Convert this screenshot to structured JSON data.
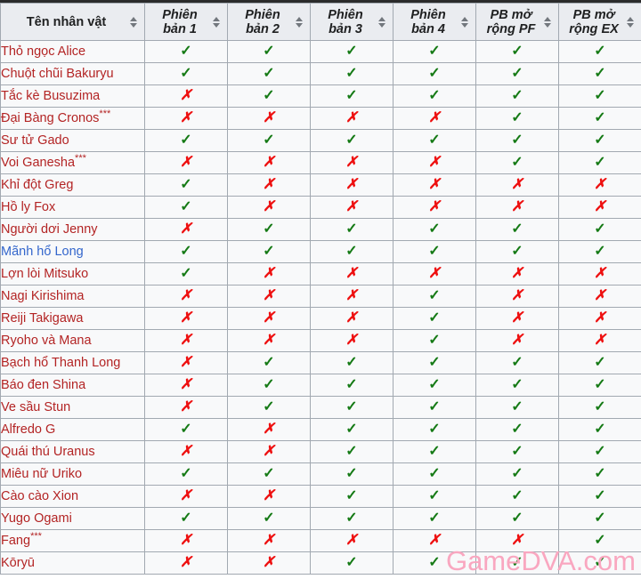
{
  "table": {
    "sort_icon_name": "sort-icon",
    "columns": [
      {
        "label": "Tên nhân vật",
        "italic": false,
        "sortable": true
      },
      {
        "label": "Phiên bản 1",
        "italic": true,
        "sortable": true
      },
      {
        "label": "Phiên bản 2",
        "italic": true,
        "sortable": true
      },
      {
        "label": "Phiên bản 3",
        "italic": true,
        "sortable": true
      },
      {
        "label": "Phiên bản 4",
        "italic": true,
        "sortable": true
      },
      {
        "label": "PB mở rộng PF",
        "italic": true,
        "sortable": true
      },
      {
        "label": "PB mở rộng EX",
        "italic": true,
        "sortable": true
      }
    ],
    "marks": {
      "yes": "✓",
      "no": "✗"
    },
    "colors": {
      "yes": "#157a15",
      "no": "#ee1111",
      "link_red": "#b32424",
      "link_blue": "#3366cc",
      "header_bg": "#eaecf0",
      "cell_bg": "#f8f9fa",
      "border": "#a2a9b1",
      "watermark": "#f9a7c0"
    },
    "rows": [
      {
        "name": "Thỏ ngọc Alice",
        "note": "",
        "link": "red",
        "values": [
          "yes",
          "yes",
          "yes",
          "yes",
          "yes",
          "yes"
        ]
      },
      {
        "name": "Chuột chũi Bakuryu",
        "note": "",
        "link": "red",
        "values": [
          "yes",
          "yes",
          "yes",
          "yes",
          "yes",
          "yes"
        ]
      },
      {
        "name": "Tắc kè Busuzima",
        "note": "",
        "link": "red",
        "values": [
          "no",
          "yes",
          "yes",
          "yes",
          "yes",
          "yes"
        ]
      },
      {
        "name": "Đại Bàng Cronos",
        "note": "***",
        "link": "red",
        "values": [
          "no",
          "no",
          "no",
          "no",
          "yes",
          "yes"
        ]
      },
      {
        "name": "Sư tử Gado",
        "note": "",
        "link": "red",
        "values": [
          "yes",
          "yes",
          "yes",
          "yes",
          "yes",
          "yes"
        ]
      },
      {
        "name": "Voi Ganesha",
        "note": "***",
        "link": "red",
        "values": [
          "no",
          "no",
          "no",
          "no",
          "yes",
          "yes"
        ]
      },
      {
        "name": "Khỉ đột Greg",
        "note": "",
        "link": "red",
        "values": [
          "yes",
          "no",
          "no",
          "no",
          "no",
          "no"
        ]
      },
      {
        "name": "Hồ ly Fox",
        "note": "",
        "link": "red",
        "values": [
          "yes",
          "no",
          "no",
          "no",
          "no",
          "no"
        ]
      },
      {
        "name": "Người dơi Jenny",
        "note": "",
        "link": "red",
        "values": [
          "no",
          "yes",
          "yes",
          "yes",
          "yes",
          "yes"
        ]
      },
      {
        "name": "Mãnh hổ Long",
        "note": "",
        "link": "blue",
        "values": [
          "yes",
          "yes",
          "yes",
          "yes",
          "yes",
          "yes"
        ]
      },
      {
        "name": "Lợn lòi Mitsuko",
        "note": "",
        "link": "red",
        "values": [
          "yes",
          "no",
          "no",
          "no",
          "no",
          "no"
        ]
      },
      {
        "name": "Nagi Kirishima",
        "note": "",
        "link": "red",
        "values": [
          "no",
          "no",
          "no",
          "yes",
          "no",
          "no"
        ]
      },
      {
        "name": "Reiji Takigawa",
        "note": "",
        "link": "red",
        "values": [
          "no",
          "no",
          "no",
          "yes",
          "no",
          "no"
        ]
      },
      {
        "name": "Ryoho và Mana",
        "note": "",
        "link": "red",
        "values": [
          "no",
          "no",
          "no",
          "yes",
          "no",
          "no"
        ]
      },
      {
        "name": "Bạch hổ Thanh Long",
        "note": "",
        "link": "red",
        "values": [
          "no",
          "yes",
          "yes",
          "yes",
          "yes",
          "yes"
        ]
      },
      {
        "name": "Báo đen Shina",
        "note": "",
        "link": "red",
        "values": [
          "no",
          "yes",
          "yes",
          "yes",
          "yes",
          "yes"
        ]
      },
      {
        "name": "Ve sầu Stun",
        "note": "",
        "link": "red",
        "values": [
          "no",
          "yes",
          "yes",
          "yes",
          "yes",
          "yes"
        ]
      },
      {
        "name": "Alfredo G",
        "note": "",
        "link": "red",
        "values": [
          "yes",
          "no",
          "yes",
          "yes",
          "yes",
          "yes"
        ]
      },
      {
        "name": "Quái thú Uranus",
        "note": "",
        "link": "red",
        "values": [
          "no",
          "no",
          "yes",
          "yes",
          "yes",
          "yes"
        ]
      },
      {
        "name": "Miêu nữ Uriko",
        "note": "",
        "link": "red",
        "values": [
          "yes",
          "yes",
          "yes",
          "yes",
          "yes",
          "yes"
        ]
      },
      {
        "name": "Cào cào Xion",
        "note": "",
        "link": "red",
        "values": [
          "no",
          "no",
          "yes",
          "yes",
          "yes",
          "yes"
        ]
      },
      {
        "name": "Yugo Ogami",
        "note": "",
        "link": "red",
        "values": [
          "yes",
          "yes",
          "yes",
          "yes",
          "yes",
          "yes"
        ]
      },
      {
        "name": "Fang",
        "note": "***",
        "link": "red",
        "values": [
          "no",
          "no",
          "no",
          "no",
          "no",
          "yes"
        ]
      },
      {
        "name": "Kōryū",
        "note": "",
        "link": "red",
        "values": [
          "no",
          "no",
          "yes",
          "yes",
          "yes",
          "yes"
        ]
      }
    ]
  },
  "watermark": {
    "text": "GameDVA.com"
  }
}
